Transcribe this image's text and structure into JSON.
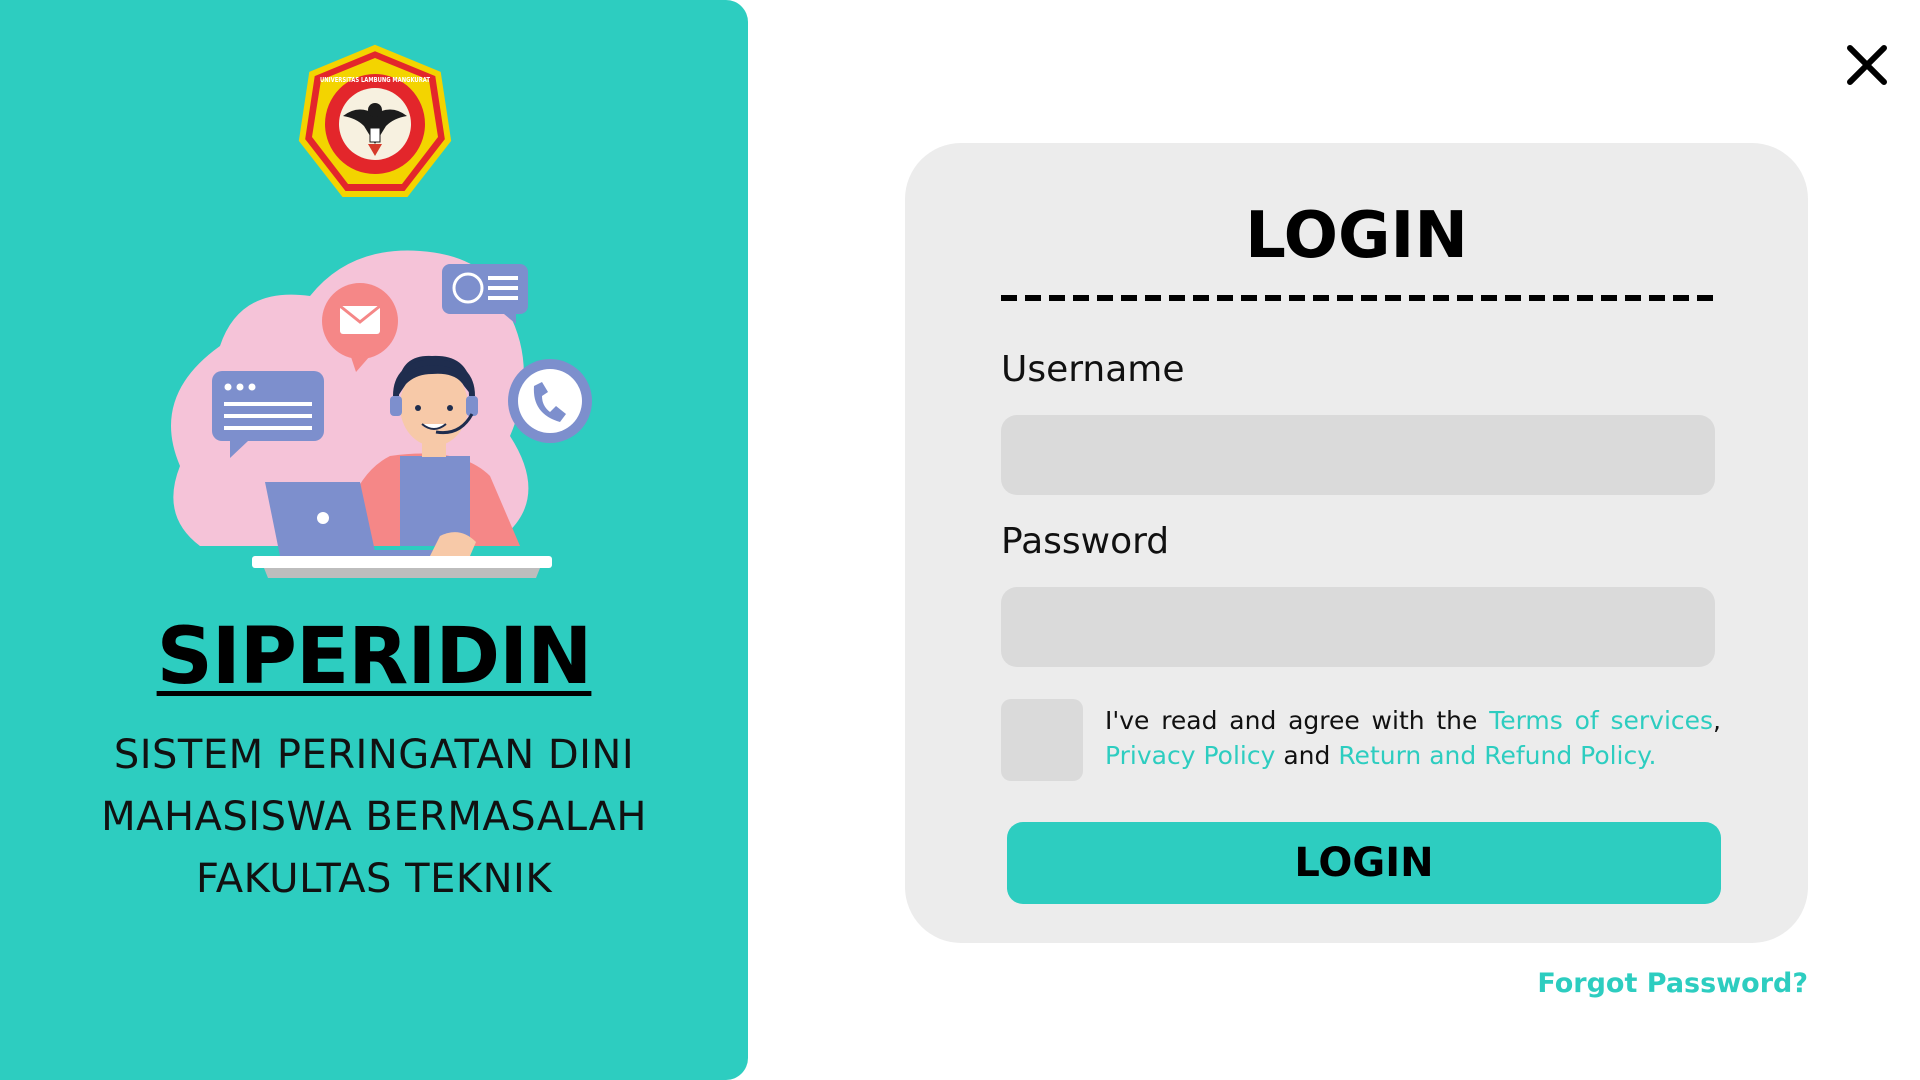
{
  "brand": {
    "logo_ring_text": "UNIVERSITAS LAMBUNG MANGKURAT",
    "app_name": "SIPERIDIN",
    "subtitle_lines": [
      "SISTEM PERINGATAN DINI",
      "MAHASISWA BERMASALAH",
      "FAKULTAS TEKNIK"
    ]
  },
  "login_card": {
    "title": "LOGIN",
    "username_label": "Username",
    "username_value": "",
    "password_label": "Password",
    "password_value": "",
    "agree_prefix": "I've read and agree with the ",
    "terms_link": "Terms of services",
    "comma": ",",
    "privacy_link": "Privacy Policy",
    "and_text": " and ",
    "refund_link": "Return and Refund Policy.",
    "submit_label": "LOGIN"
  },
  "forgot_password": "Forgot Password?",
  "colors": {
    "accent": "#2dcdc0",
    "card_bg": "#ececec",
    "input_bg": "#dadada"
  }
}
